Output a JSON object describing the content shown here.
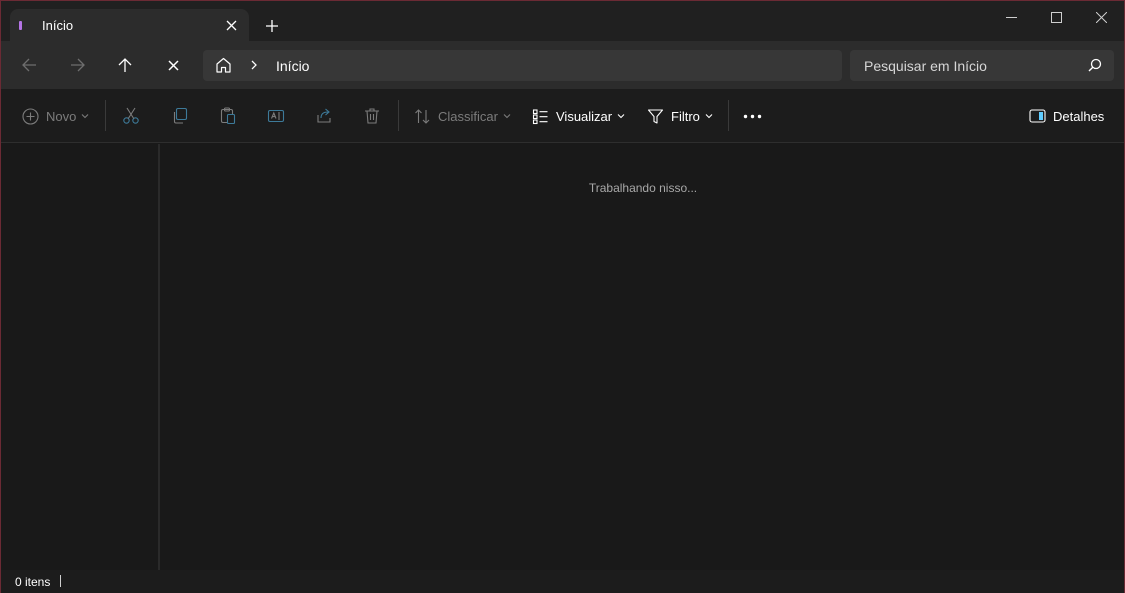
{
  "tab": {
    "title": "Início"
  },
  "address": {
    "breadcrumb": "Início"
  },
  "search": {
    "placeholder": "Pesquisar em Início"
  },
  "commands": {
    "new": "Novo",
    "sort": "Classificar",
    "view": "Visualizar",
    "filter": "Filtro",
    "details": "Detalhes"
  },
  "content": {
    "status_message": "Trabalhando nisso..."
  },
  "statusbar": {
    "item_count": "0 itens"
  },
  "icons": {
    "tab": "folder-home-icon",
    "close": "close-icon",
    "new_tab": "plus-icon",
    "minimize": "minimize-icon",
    "maximize": "maximize-icon",
    "back": "arrow-left-icon",
    "forward": "arrow-right-icon",
    "up": "arrow-up-icon",
    "stop": "close-icon",
    "home": "home-icon",
    "search": "search-icon",
    "cut": "scissors-icon",
    "copy": "copy-icon",
    "paste": "paste-icon",
    "rename": "rename-icon",
    "share": "share-icon",
    "delete": "trash-icon",
    "more": "more-icon",
    "details_pane": "details-pane-icon"
  },
  "colors": {
    "accent": "#60cdff",
    "tab_marker": "#b574e6",
    "window_border": "#6b2a34"
  }
}
